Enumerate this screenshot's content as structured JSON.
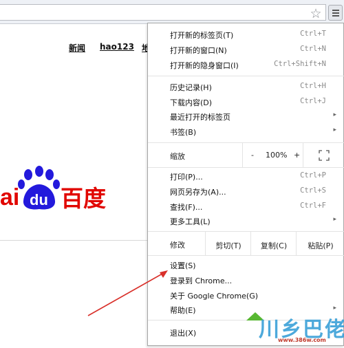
{
  "toolbar": {
    "star_icon": "star-icon",
    "menu_icon": "hamburger-menu-icon"
  },
  "page": {
    "nav_links": [
      "新闻",
      "hao123",
      "地"
    ],
    "logo_text_latin": "ai",
    "logo_text_du": "du",
    "logo_text_cn": "百度",
    "brand_colors": {
      "red": "#e10601",
      "blue": "#2319dc"
    }
  },
  "menu": {
    "group1": [
      {
        "label": "打开新的标签页(T)",
        "shortcut": "Ctrl+T"
      },
      {
        "label": "打开新的窗口(N)",
        "shortcut": "Ctrl+N"
      },
      {
        "label": "打开新的隐身窗口(I)",
        "shortcut": "Ctrl+Shift+N"
      }
    ],
    "group2": [
      {
        "label": "历史记录(H)",
        "shortcut": "Ctrl+H"
      },
      {
        "label": "下载内容(D)",
        "shortcut": "Ctrl+J"
      },
      {
        "label": "最近打开的标签页",
        "submenu": "▸"
      },
      {
        "label": "书签(B)",
        "submenu": "▸"
      }
    ],
    "zoom": {
      "label": "缩放",
      "minus": "-",
      "value": "100%",
      "plus": "+",
      "fullscreen_icon": "fullscreen-icon"
    },
    "group3": [
      {
        "label": "打印(P)...",
        "shortcut": "Ctrl+P"
      },
      {
        "label": "网页另存为(A)...",
        "shortcut": "Ctrl+S"
      },
      {
        "label": "查找(F)...",
        "shortcut": "Ctrl+F"
      },
      {
        "label": "更多工具(L)",
        "submenu": "▸"
      }
    ],
    "edit": {
      "label": "修改",
      "cut": "剪切(T)",
      "copy": "复制(C)",
      "paste": "粘贴(P)"
    },
    "group4": [
      {
        "label": "设置(S)"
      },
      {
        "label": "登录到 Chrome..."
      },
      {
        "label": "关于 Google Chrome(G)"
      },
      {
        "label": "帮助(E)",
        "submenu": "▸"
      }
    ],
    "exit": {
      "label": "退出(X)"
    }
  },
  "watermark": {
    "text": "川乡巴佬",
    "url": "www.386w.com"
  },
  "annotation_color": "#d9302a"
}
